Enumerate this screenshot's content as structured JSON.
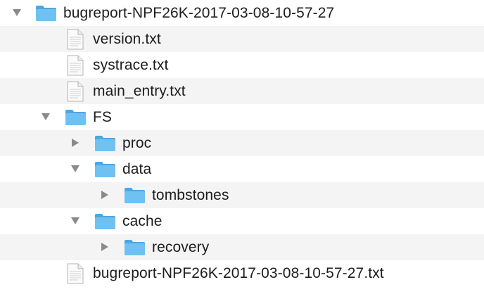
{
  "tree": {
    "rows": [
      {
        "label": "bugreport-NPF26K-2017-03-08-10-57-27",
        "type": "folder",
        "expanded": true
      },
      {
        "label": "version.txt",
        "type": "file"
      },
      {
        "label": "systrace.txt",
        "type": "file"
      },
      {
        "label": "main_entry.txt",
        "type": "file"
      },
      {
        "label": "FS",
        "type": "folder",
        "expanded": true
      },
      {
        "label": "proc",
        "type": "folder",
        "expanded": false
      },
      {
        "label": "data",
        "type": "folder",
        "expanded": true
      },
      {
        "label": "tombstones",
        "type": "folder",
        "expanded": false
      },
      {
        "label": "cache",
        "type": "folder",
        "expanded": true
      },
      {
        "label": "recovery",
        "type": "folder",
        "expanded": false
      },
      {
        "label": "bugreport-NPF26K-2017-03-08-10-57-27.txt",
        "type": "file"
      }
    ]
  },
  "colors": {
    "row_alt": "#f4f4f5",
    "folder_body": "#6fc1f2",
    "folder_tab": "#4fa6df",
    "triangle": "#8a8a8a"
  }
}
